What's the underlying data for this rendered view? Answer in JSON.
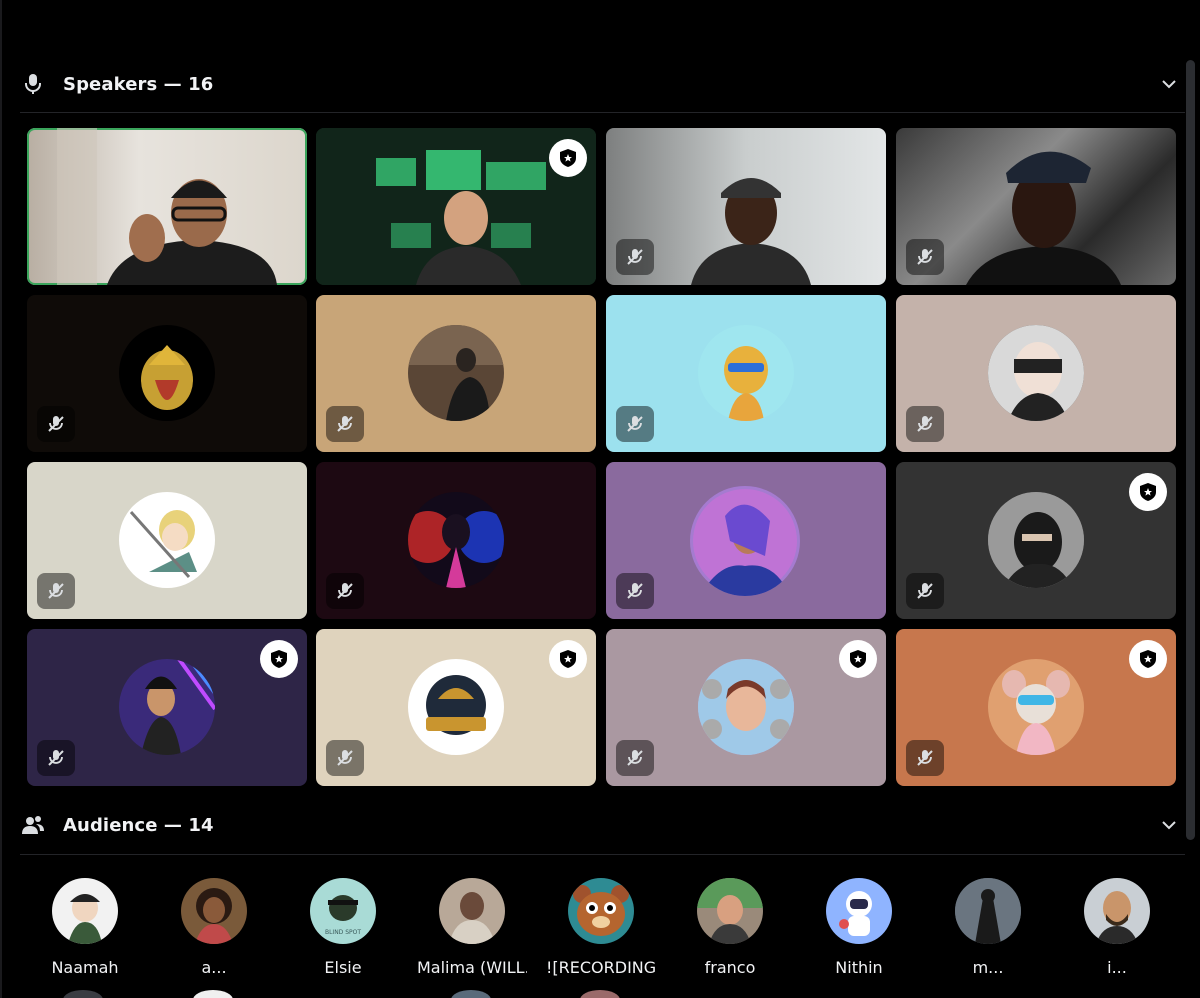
{
  "speakers": {
    "title": "Speakers — 16",
    "icon": "microphone-icon"
  },
  "audience": {
    "title": "Audience — 14",
    "icon": "people-icon",
    "members": [
      {
        "name": "Naamah",
        "color": "#e9ecef"
      },
      {
        "name": "a...",
        "color": "#5a3b2a"
      },
      {
        "name": "Elsie",
        "color": "#a9dbd6"
      },
      {
        "name": "Malima (WILL...",
        "color": "#8a7a6a"
      },
      {
        "name": "![RECORDING...",
        "color": "#2e8b93"
      },
      {
        "name": "franco",
        "color": "#b9a08a"
      },
      {
        "name": "Nithin",
        "color": "#8fb4ff"
      },
      {
        "name": "m...",
        "color": "#4a5560"
      },
      {
        "name": "i...",
        "color": "#7a8288"
      }
    ]
  },
  "colors": {
    "speaking_ring": "#3ba55c",
    "background": "#000000"
  }
}
